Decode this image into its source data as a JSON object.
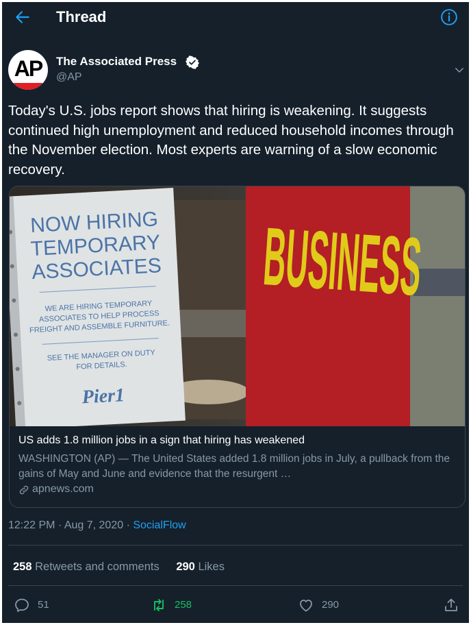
{
  "header": {
    "title": "Thread",
    "back_icon": "arrow-left-icon",
    "info_icon": "info-icon"
  },
  "tweet": {
    "avatar_text": "AP",
    "author_name": "The Associated Press",
    "verified_icon": "verified-badge-icon",
    "handle": "@AP",
    "text": "Today's U.S. jobs report shows that hiring is weakening. It suggests continued high unemployment and reduced household incomes through the November election. Most experts are warning of a slow economic recovery.",
    "card": {
      "image_sign": {
        "heading": [
          "NOW HIRING",
          "TEMPORARY",
          "ASSOCIATES"
        ],
        "body": [
          "WE ARE HIRING TEMPORARY",
          "ASSOCIATES TO HELP PROCESS",
          "FREIGHT AND ASSEMBLE FURNITURE."
        ],
        "footer": [
          "SEE THE MANAGER ON DUTY",
          "FOR DETAILS."
        ],
        "logo": "Pier1"
      },
      "image_banner_text": "BUSINESS",
      "title": "US adds 1.8 million jobs in a sign that hiring has weakened",
      "description": "WASHINGTON (AP) — The United States added 1.8 million jobs in July, a pullback from the gains of May and June and evidence that the resurgent …",
      "domain": "apnews.com"
    },
    "timestamp": "12:22 PM · Aug 7, 2020 · ",
    "source": "SocialFlow",
    "stats": {
      "retweets_count": "258",
      "retweets_label": "Retweets and comments",
      "likes_count": "290",
      "likes_label": "Likes"
    },
    "actions": {
      "reply_count": "51",
      "retweet_count": "258",
      "like_count": "290"
    }
  },
  "colors": {
    "background": "#15202b",
    "accent": "#1da1f2",
    "retweet_green": "#17bf63",
    "muted_text": "#8899a6",
    "divider": "#38444d"
  }
}
